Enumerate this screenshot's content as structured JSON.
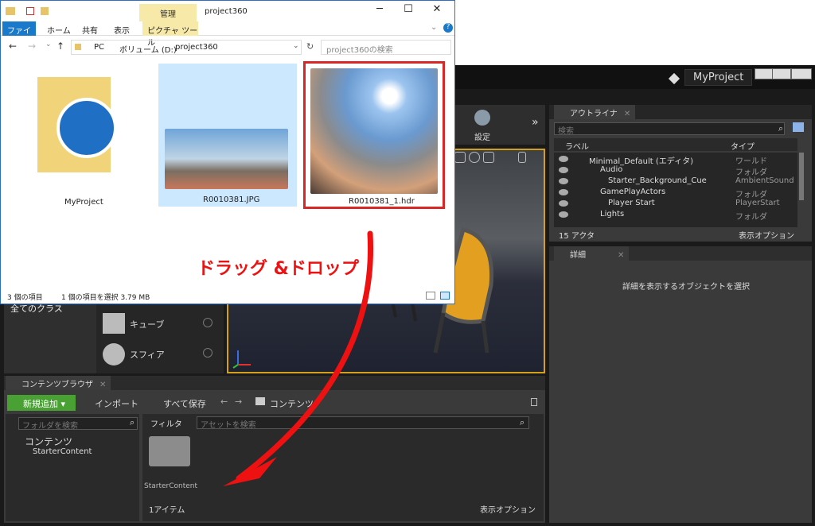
{
  "unreal": {
    "project_name": "MyProject",
    "toolbar_settings": "設定",
    "outliner": {
      "tab": "アウトライナ",
      "search_placeholder": "検索",
      "col_label": "ラベル",
      "col_type": "タイプ",
      "rows": [
        {
          "label": "Minimal_Default (エディタ)",
          "type": "ワールド"
        },
        {
          "label": "Audio",
          "type": "フォルダ"
        },
        {
          "label": "Starter_Background_Cue",
          "type": "AmbientSound"
        },
        {
          "label": "GamePlayActors",
          "type": "フォルダ"
        },
        {
          "label": "Player Start",
          "type": "PlayerStart"
        },
        {
          "label": "Lights",
          "type": "フォルダ"
        }
      ],
      "actor_count": "15 アクタ",
      "view_options": "表示オプション"
    },
    "details": {
      "tab": "詳細",
      "empty_message": "詳細を表示するオブジェクトを選択"
    },
    "modes": {
      "all_classes": "全てのクラス",
      "cube": "キューブ",
      "sphere": "スフィア"
    },
    "content_browser": {
      "tab": "コンテンツブラウザ",
      "add_new": "新規追加",
      "import": "インポート",
      "save_all": "すべて保存",
      "path": "コンテンツ",
      "folder_search": "フォルダを検索",
      "tree_root": "コンテンツ",
      "tree_child": "StarterContent",
      "filter": "フィルタ",
      "asset_search": "アセットを検索",
      "asset_name": "StarterContent",
      "item_count": "1アイテム",
      "view_options": "表示オプション"
    }
  },
  "explorer": {
    "title": "project360",
    "manage_tab": "管理",
    "ribbon_tabs": [
      "ファイル",
      "ホーム",
      "共有",
      "表示",
      "ピクチャ ツール"
    ],
    "breadcrumb": [
      "PC",
      "ボリューム (D:)",
      "project360"
    ],
    "search_placeholder": "project360の検索",
    "items": [
      {
        "name": "MyProject"
      },
      {
        "name": "R0010381.JPG"
      },
      {
        "name": "R0010381_1.hdr"
      }
    ],
    "status_count": "3 個の項目",
    "status_selected": "1 個の項目を選択  3.79 MB"
  },
  "annotation": {
    "text": "ドラッグ &ドロップ",
    "color": "#ee1111"
  }
}
